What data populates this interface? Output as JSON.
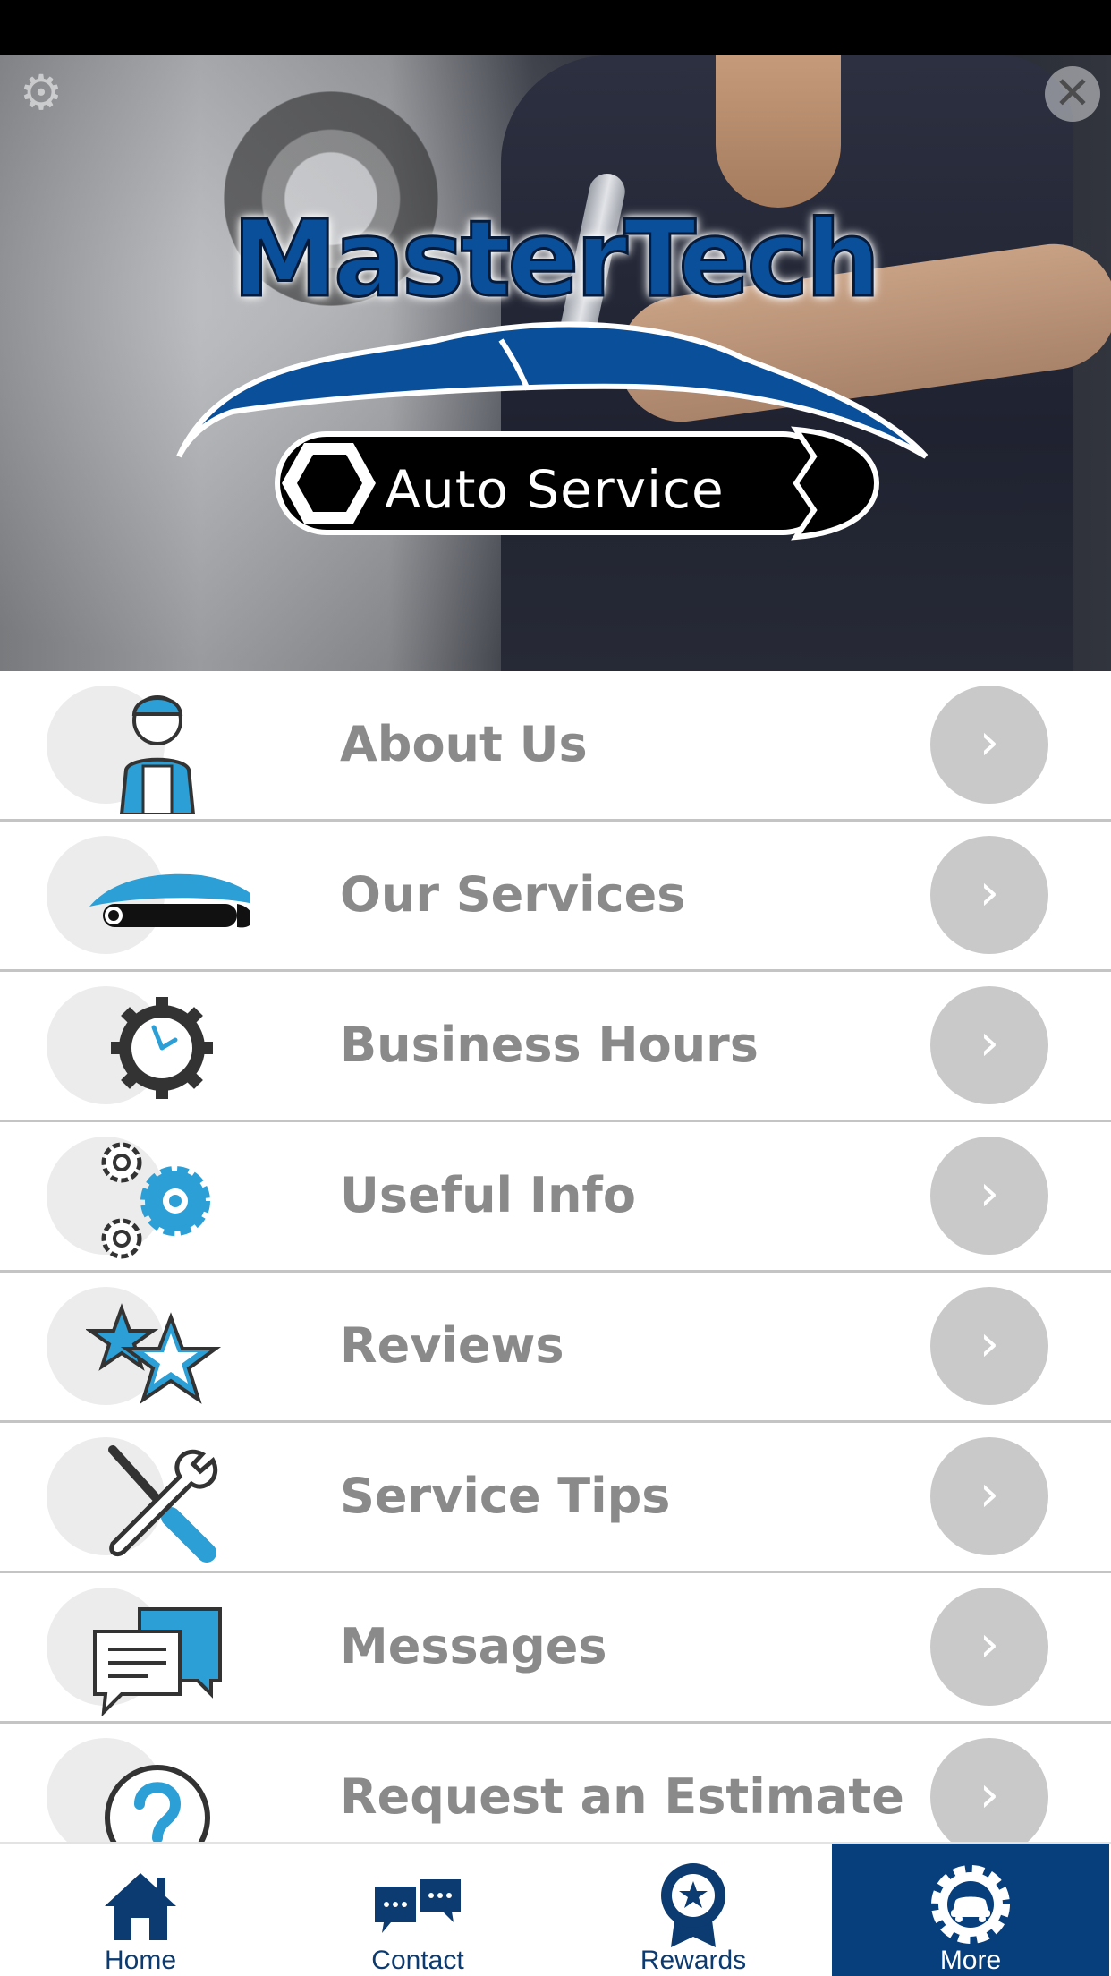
{
  "header": {
    "settings_icon": "gear-icon",
    "close_icon": "close-icon",
    "logo": {
      "title": "MasterTech",
      "subtitle": "Auto Service"
    }
  },
  "menu": {
    "items": [
      {
        "label": "About Us",
        "icon": "mechanic-icon"
      },
      {
        "label": "Our Services",
        "icon": "car-logo-icon"
      },
      {
        "label": "Business Hours",
        "icon": "clock-gear-icon"
      },
      {
        "label": "Useful Info",
        "icon": "gears-icon"
      },
      {
        "label": "Reviews",
        "icon": "stars-icon"
      },
      {
        "label": "Service Tips",
        "icon": "tools-icon"
      },
      {
        "label": "Messages",
        "icon": "chat-icon"
      },
      {
        "label": "Request an Estimate",
        "icon": "question-icon"
      }
    ],
    "chevron": "›"
  },
  "tab_bar": {
    "tabs": [
      {
        "label": "Home",
        "icon": "home-icon",
        "active": false
      },
      {
        "label": "Contact",
        "icon": "chat-bubbles-icon",
        "active": false
      },
      {
        "label": "Rewards",
        "icon": "award-badge-icon",
        "active": false
      },
      {
        "label": "More",
        "icon": "car-gear-icon",
        "active": true
      }
    ]
  },
  "colors": {
    "brand_blue": "#073f7c",
    "accent_cyan": "#2b9fd6",
    "label_gray": "#8a8a8a",
    "chevron_gray": "#c9c9c9"
  }
}
